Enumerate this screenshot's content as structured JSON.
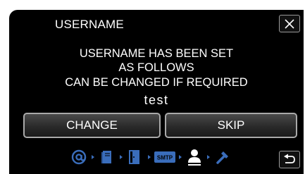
{
  "header": {
    "title": "USERNAME",
    "close_icon": "close-icon"
  },
  "message": {
    "line1": "USERNAME HAS BEEN SET",
    "line2": "AS FOLLOWS",
    "line3": "CAN BE CHANGED IF REQUIRED"
  },
  "username_value": "test",
  "buttons": {
    "change_label": "CHANGE",
    "skip_label": "SKIP"
  },
  "steps": {
    "items": [
      {
        "icon": "at-sign-icon",
        "state": "inactive"
      },
      {
        "icon": "book-icon",
        "state": "inactive"
      },
      {
        "icon": "door-icon",
        "state": "inactive"
      },
      {
        "icon": "smtp-icon",
        "label": "SMTP",
        "state": "inactive"
      },
      {
        "icon": "user-icon",
        "state": "active"
      },
      {
        "icon": "wrench-icon",
        "state": "inactive"
      }
    ],
    "active_color": "#ffffff",
    "inactive_color": "#3a6dbb"
  },
  "footer": {
    "back_icon": "return-arrow-icon"
  },
  "colors": {
    "background": "#000000",
    "text": "#ffffff",
    "button_border": "#a9a9a9",
    "step_blue": "#3a6dbb"
  }
}
